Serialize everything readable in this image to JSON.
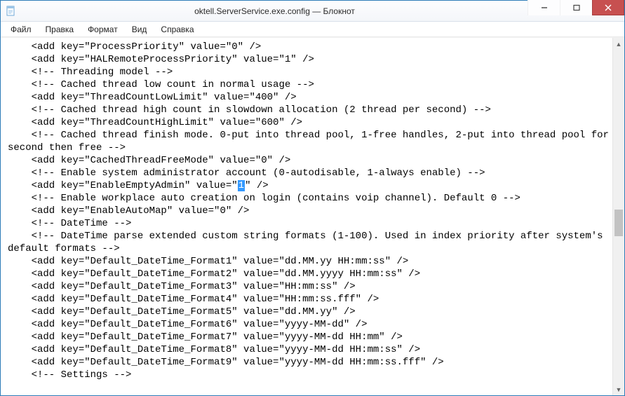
{
  "window": {
    "title": "oktell.ServerService.exe.config — Блокнот"
  },
  "menubar": {
    "items": [
      "Файл",
      "Правка",
      "Формат",
      "Вид",
      "Справка"
    ]
  },
  "editor": {
    "selected_char": "1",
    "lines_before": [
      "    <add key=\"ProcessPriority\" value=\"0\" />",
      "    <add key=\"HALRemoteProcessPriority\" value=\"1\" />",
      "    <!-- Threading model -->",
      "    <!-- Cached thread low count in normal usage -->",
      "    <add key=\"ThreadCountLowLimit\" value=\"400\" />",
      "    <!-- Cached thread high count in slowdown allocation (2 thread per second) -->",
      "    <add key=\"ThreadCountHighLimit\" value=\"600\" />",
      "    <!-- Cached thread finish mode. 0-put into thread pool, 1-free handles, 2-put into thread pool for",
      "second then free -->",
      "    <add key=\"CachedThreadFreeMode\" value=\"0\" />",
      "    <!-- Enable system administrator account (0-autodisable, 1-always enable) -->"
    ],
    "sel_line_prefix": "    <add key=\"EnableEmptyAdmin\" value=\"",
    "sel_line_suffix": "\" />",
    "lines_after": [
      "    <!-- Enable workplace auto creation on login (contains voip channel). Default 0 -->",
      "    <add key=\"EnableAutoMap\" value=\"0\" />",
      "    <!-- DateTime -->",
      "    <!-- DateTime parse extended custom string formats (1-100). Used in index priority after system's",
      "default formats -->",
      "    <add key=\"Default_DateTime_Format1\" value=\"dd.MM.yy HH:mm:ss\" />",
      "    <add key=\"Default_DateTime_Format2\" value=\"dd.MM.yyyy HH:mm:ss\" />",
      "    <add key=\"Default_DateTime_Format3\" value=\"HH:mm:ss\" />",
      "    <add key=\"Default_DateTime_Format4\" value=\"HH:mm:ss.fff\" />",
      "    <add key=\"Default_DateTime_Format5\" value=\"dd.MM.yy\" />",
      "    <add key=\"Default_DateTime_Format6\" value=\"yyyy-MM-dd\" />",
      "    <add key=\"Default_DateTime_Format7\" value=\"yyyy-MM-dd HH:mm\" />",
      "    <add key=\"Default_DateTime_Format8\" value=\"yyyy-MM-dd HH:mm:ss\" />",
      "    <add key=\"Default_DateTime_Format9\" value=\"yyyy-MM-dd HH:mm:ss.fff\" />",
      "    <!-- Settings -->"
    ]
  }
}
